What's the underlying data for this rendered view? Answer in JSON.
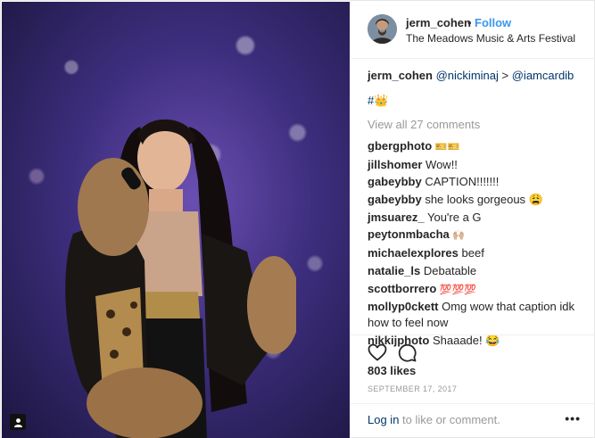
{
  "header": {
    "username": "jerm_cohen",
    "separator": "•",
    "follow_label": "Follow",
    "location": "The Meadows Music & Arts Festival"
  },
  "caption": {
    "username": "jerm_cohen",
    "mention1": "@nickiminaj",
    "separator": ">",
    "mention2": "@iamcardib",
    "hashtag": "#👑"
  },
  "view_all": "View all 27 comments",
  "comments": [
    {
      "user": "gbergphoto",
      "text": "🎫🎫"
    },
    {
      "user": "jillshomer",
      "text": "Wow!!"
    },
    {
      "user": "gabeybby",
      "text": "CAPTION!!!!!!!"
    },
    {
      "user": "gabeybby",
      "text": "she looks gorgeous 😩"
    },
    {
      "user": "jmsuarez_",
      "text": "You're a G"
    },
    {
      "user": "peytonmbacha",
      "text": "🙌🏼"
    },
    {
      "user": "michaelexplores",
      "text": "beef"
    },
    {
      "user": "natalie_ls",
      "text": "Debatable"
    },
    {
      "user": "scottborrero",
      "text": "💯💯💯"
    },
    {
      "user": "mollyp0ckett",
      "text": "Omg wow that caption idk how to feel now"
    },
    {
      "user": "nikkijphoto",
      "text": "Shaaade! 😂"
    }
  ],
  "likes": "803 likes",
  "date": "SEPTEMBER 17, 2017",
  "footer": {
    "login_link": "Log in",
    "login_rest": " to like or comment.",
    "more_label": "•••"
  },
  "icons": {
    "like": "heart-outline-icon",
    "comment": "comment-bubble-icon",
    "photo_badge": "user-tag-icon"
  },
  "colors": {
    "link_blue": "#3897f0",
    "mention": "#003569",
    "muted": "#999999",
    "text": "#262626"
  }
}
